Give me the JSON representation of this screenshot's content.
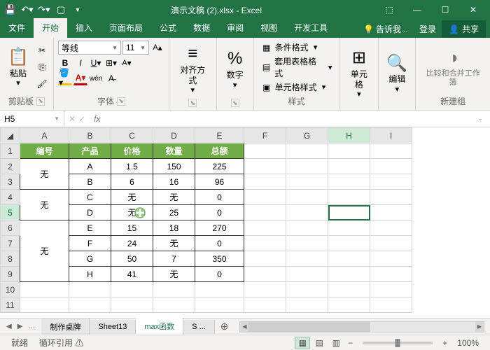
{
  "title": "演示文稿 (2).xlsx - Excel",
  "tabs": {
    "file": "文件",
    "home": "开始",
    "insert": "插入",
    "layout": "页面布局",
    "formula": "公式",
    "data": "数据",
    "review": "审阅",
    "view": "视图",
    "dev": "开发工具",
    "tell": "告诉我...",
    "login": "登录",
    "share": "共享"
  },
  "ribbon": {
    "clipboard": {
      "paste": "粘贴",
      "label": "剪贴板"
    },
    "font": {
      "name": "等线",
      "size": "11",
      "label": "字体",
      "wen": "wén"
    },
    "align": {
      "label": "对齐方式"
    },
    "number": {
      "label": "数字"
    },
    "styles": {
      "cond": "条件格式",
      "table": "套用表格格式",
      "cell": "单元格样式",
      "label": "样式"
    },
    "cells": {
      "label": "单元格"
    },
    "editing": {
      "label": "编辑"
    },
    "newgroup": {
      "compare": "比较和合并工作簿",
      "label": "新建组"
    }
  },
  "namebox": "H5",
  "columns": [
    "A",
    "B",
    "C",
    "D",
    "E",
    "F",
    "G",
    "H",
    "I"
  ],
  "chart_data": {
    "type": "table",
    "headers": [
      "编号",
      "产品",
      "价格",
      "数量",
      "总额"
    ],
    "rows": [
      {
        "id": "无",
        "rowspan": 2,
        "product": "A",
        "price": "1.5",
        "qty": "150",
        "total": "225"
      },
      {
        "product": "B",
        "price": "6",
        "qty": "16",
        "total": "96"
      },
      {
        "id": "无",
        "rowspan": 2,
        "product": "C",
        "price": "无",
        "qty": "无",
        "total": "0"
      },
      {
        "product": "D",
        "price": "无",
        "qty": "25",
        "total": "0"
      },
      {
        "id": "无",
        "rowspan": 4,
        "product": "E",
        "price": "15",
        "qty": "18",
        "total": "270"
      },
      {
        "product": "F",
        "price": "24",
        "qty": "无",
        "total": "0"
      },
      {
        "product": "G",
        "price": "50",
        "qty": "7",
        "total": "350"
      },
      {
        "product": "H",
        "price": "41",
        "qty": "无",
        "total": "0"
      }
    ]
  },
  "sheets": {
    "tab1": "制作桌牌",
    "tab2": "Sheet13",
    "tab3": "max函数",
    "tab4": "S ...",
    "add": "⊕"
  },
  "status": {
    "ready": "就绪",
    "circ": "循环引用",
    "zoom": "100%"
  },
  "colwidths": {
    "rh": 28,
    "A": 70,
    "B": 60,
    "C": 60,
    "D": 60,
    "E": 70,
    "rest": 60
  },
  "active": {
    "row": 5,
    "col": "H"
  }
}
